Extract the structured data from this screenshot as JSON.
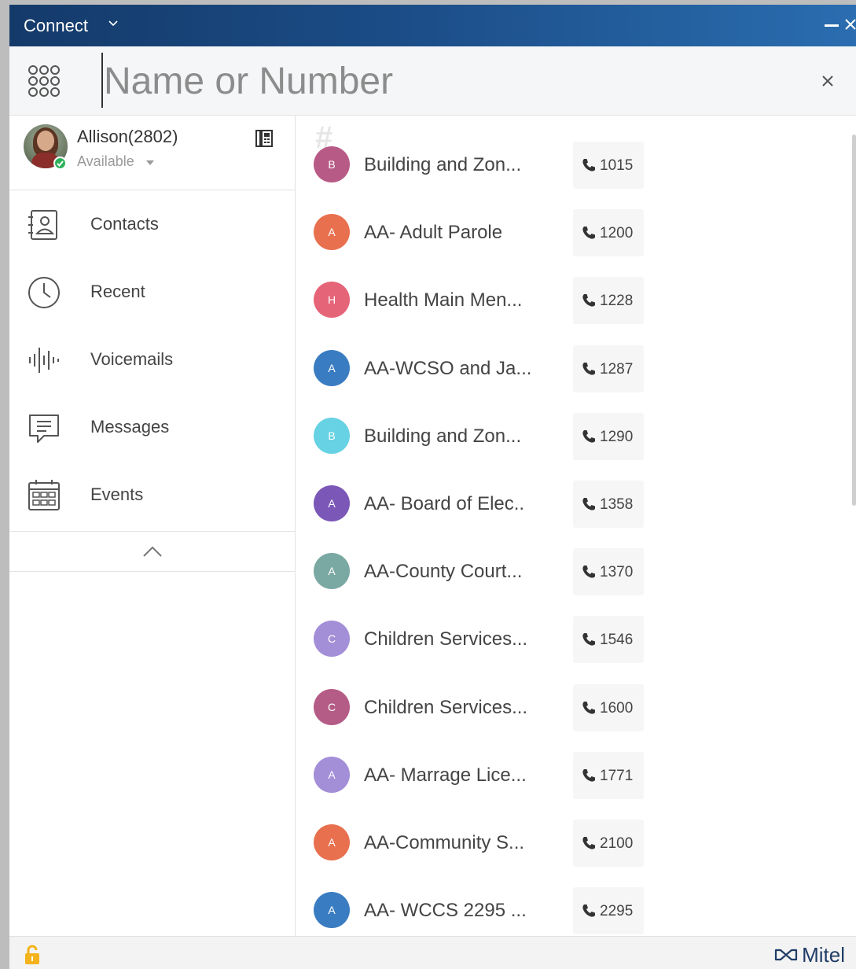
{
  "window": {
    "title": "Connect"
  },
  "search": {
    "placeholder": "Name or Number"
  },
  "user": {
    "name": "Allison(2802)",
    "presence": "Available"
  },
  "nav": {
    "items": [
      {
        "label": "Contacts",
        "icon": "contacts-icon"
      },
      {
        "label": "Recent",
        "icon": "clock-icon"
      },
      {
        "label": "Voicemails",
        "icon": "voicemail-icon"
      },
      {
        "label": "Messages",
        "icon": "messages-icon"
      },
      {
        "label": "Events",
        "icon": "calendar-icon"
      }
    ]
  },
  "list": {
    "section": "#",
    "contacts": [
      {
        "initial": "B",
        "name": "Building and Zon...",
        "ext": "1015",
        "color": "#b85a86"
      },
      {
        "initial": "A",
        "name": "AA- Adult Parole",
        "ext": "1200",
        "color": "#e8704f"
      },
      {
        "initial": "H",
        "name": "Health Main Men...",
        "ext": "1228",
        "color": "#e56478"
      },
      {
        "initial": "A",
        "name": "AA-WCSO and Ja...",
        "ext": "1287",
        "color": "#3a7cc1"
      },
      {
        "initial": "B",
        "name": "Building and Zon...",
        "ext": "1290",
        "color": "#67d2e3"
      },
      {
        "initial": "A",
        "name": "AA- Board of Elec..",
        "ext": "1358",
        "color": "#7b57b7"
      },
      {
        "initial": "A",
        "name": "AA-County Court...",
        "ext": "1370",
        "color": "#7aa8a3"
      },
      {
        "initial": "C",
        "name": "Children Services...",
        "ext": "1546",
        "color": "#a38ed8"
      },
      {
        "initial": "C",
        "name": "Children Services...",
        "ext": "1600",
        "color": "#b45b86"
      },
      {
        "initial": "A",
        "name": "AA- Marrage Lice...",
        "ext": "1771",
        "color": "#a38ed8"
      },
      {
        "initial": "A",
        "name": "AA-Community S...",
        "ext": "2100",
        "color": "#e8704f"
      },
      {
        "initial": "A",
        "name": "AA- WCCS 2295 ...",
        "ext": "2295",
        "color": "#3a7cc1"
      }
    ]
  },
  "footer": {
    "brand": "Mitel"
  },
  "colors": {
    "titlebar": "#1b4c86",
    "status_available": "#2fb15b",
    "lock": "#f4b21b",
    "brand": "#1f3c66"
  }
}
